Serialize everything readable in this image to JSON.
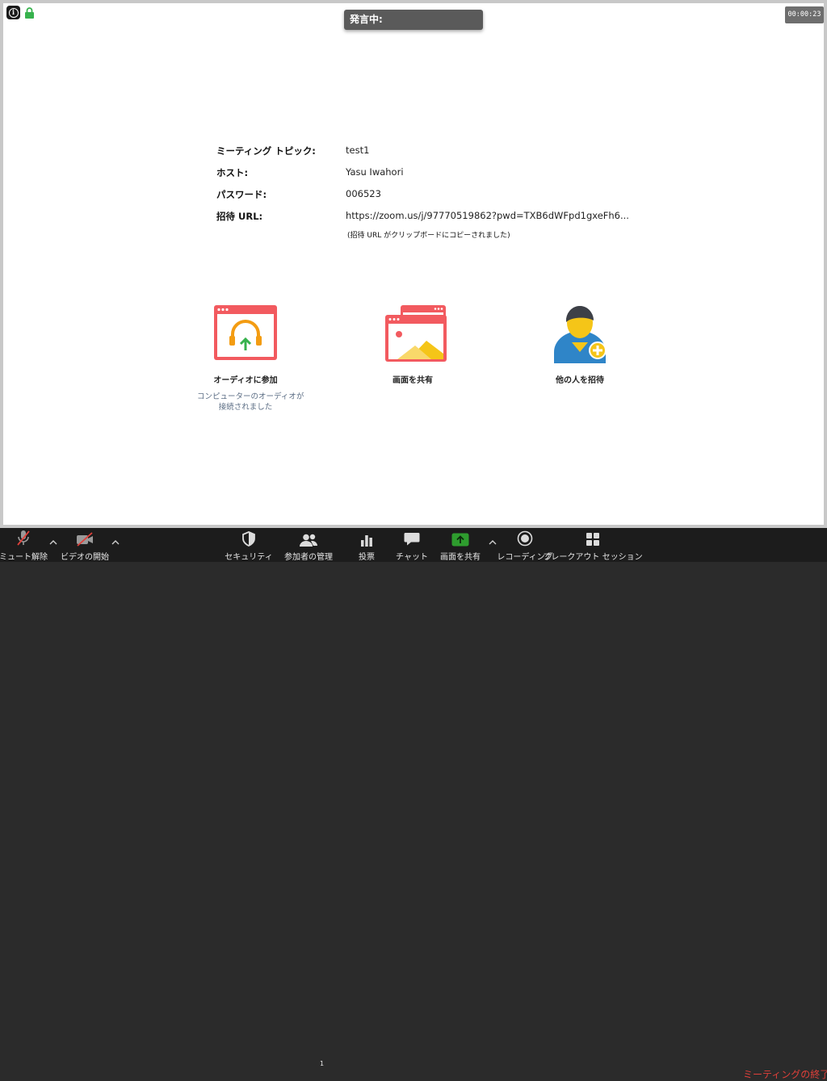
{
  "topbar": {
    "speaking_label": "発言中:",
    "elapsed_time": "00:00:23"
  },
  "meeting_info": {
    "rows": [
      {
        "label": "ミーティング トピック:",
        "value": "test1"
      },
      {
        "label": "ホスト:",
        "value": "Yasu Iwahori"
      },
      {
        "label": "パスワード:",
        "value": "006523"
      },
      {
        "label": "招待 URL:",
        "value": "https://zoom.us/j/97770519862?pwd=TXB6dWFpd1gxeFh6..."
      }
    ],
    "clipboard_note": "(招待 URL がクリップボードにコピーされました)"
  },
  "actions": {
    "join_audio": {
      "label": "オーディオに参加",
      "status_line1": "コンピューターのオーディオが",
      "status_line2": "接続されました"
    },
    "share_screen": {
      "label": "画面を共有"
    },
    "invite": {
      "label": "他の人を招待"
    }
  },
  "toolbar": {
    "unmute": "ミュート解除",
    "start_video": "ビデオの開始",
    "security": "セキュリティ",
    "participants": "参加者の管理",
    "participant_count": "1",
    "polls": "投票",
    "chat": "チャット",
    "share_screen": "画面を共有",
    "record": "レコーディング",
    "breakout": "ブレークアウト セッション",
    "end_meeting": "ミーティングの終了"
  },
  "colors": {
    "accent_red": "#e0403a",
    "share_green": "#2e9d2e",
    "tile_red": "#f25a5f",
    "toolbar_bg": "#1c1c1c"
  }
}
